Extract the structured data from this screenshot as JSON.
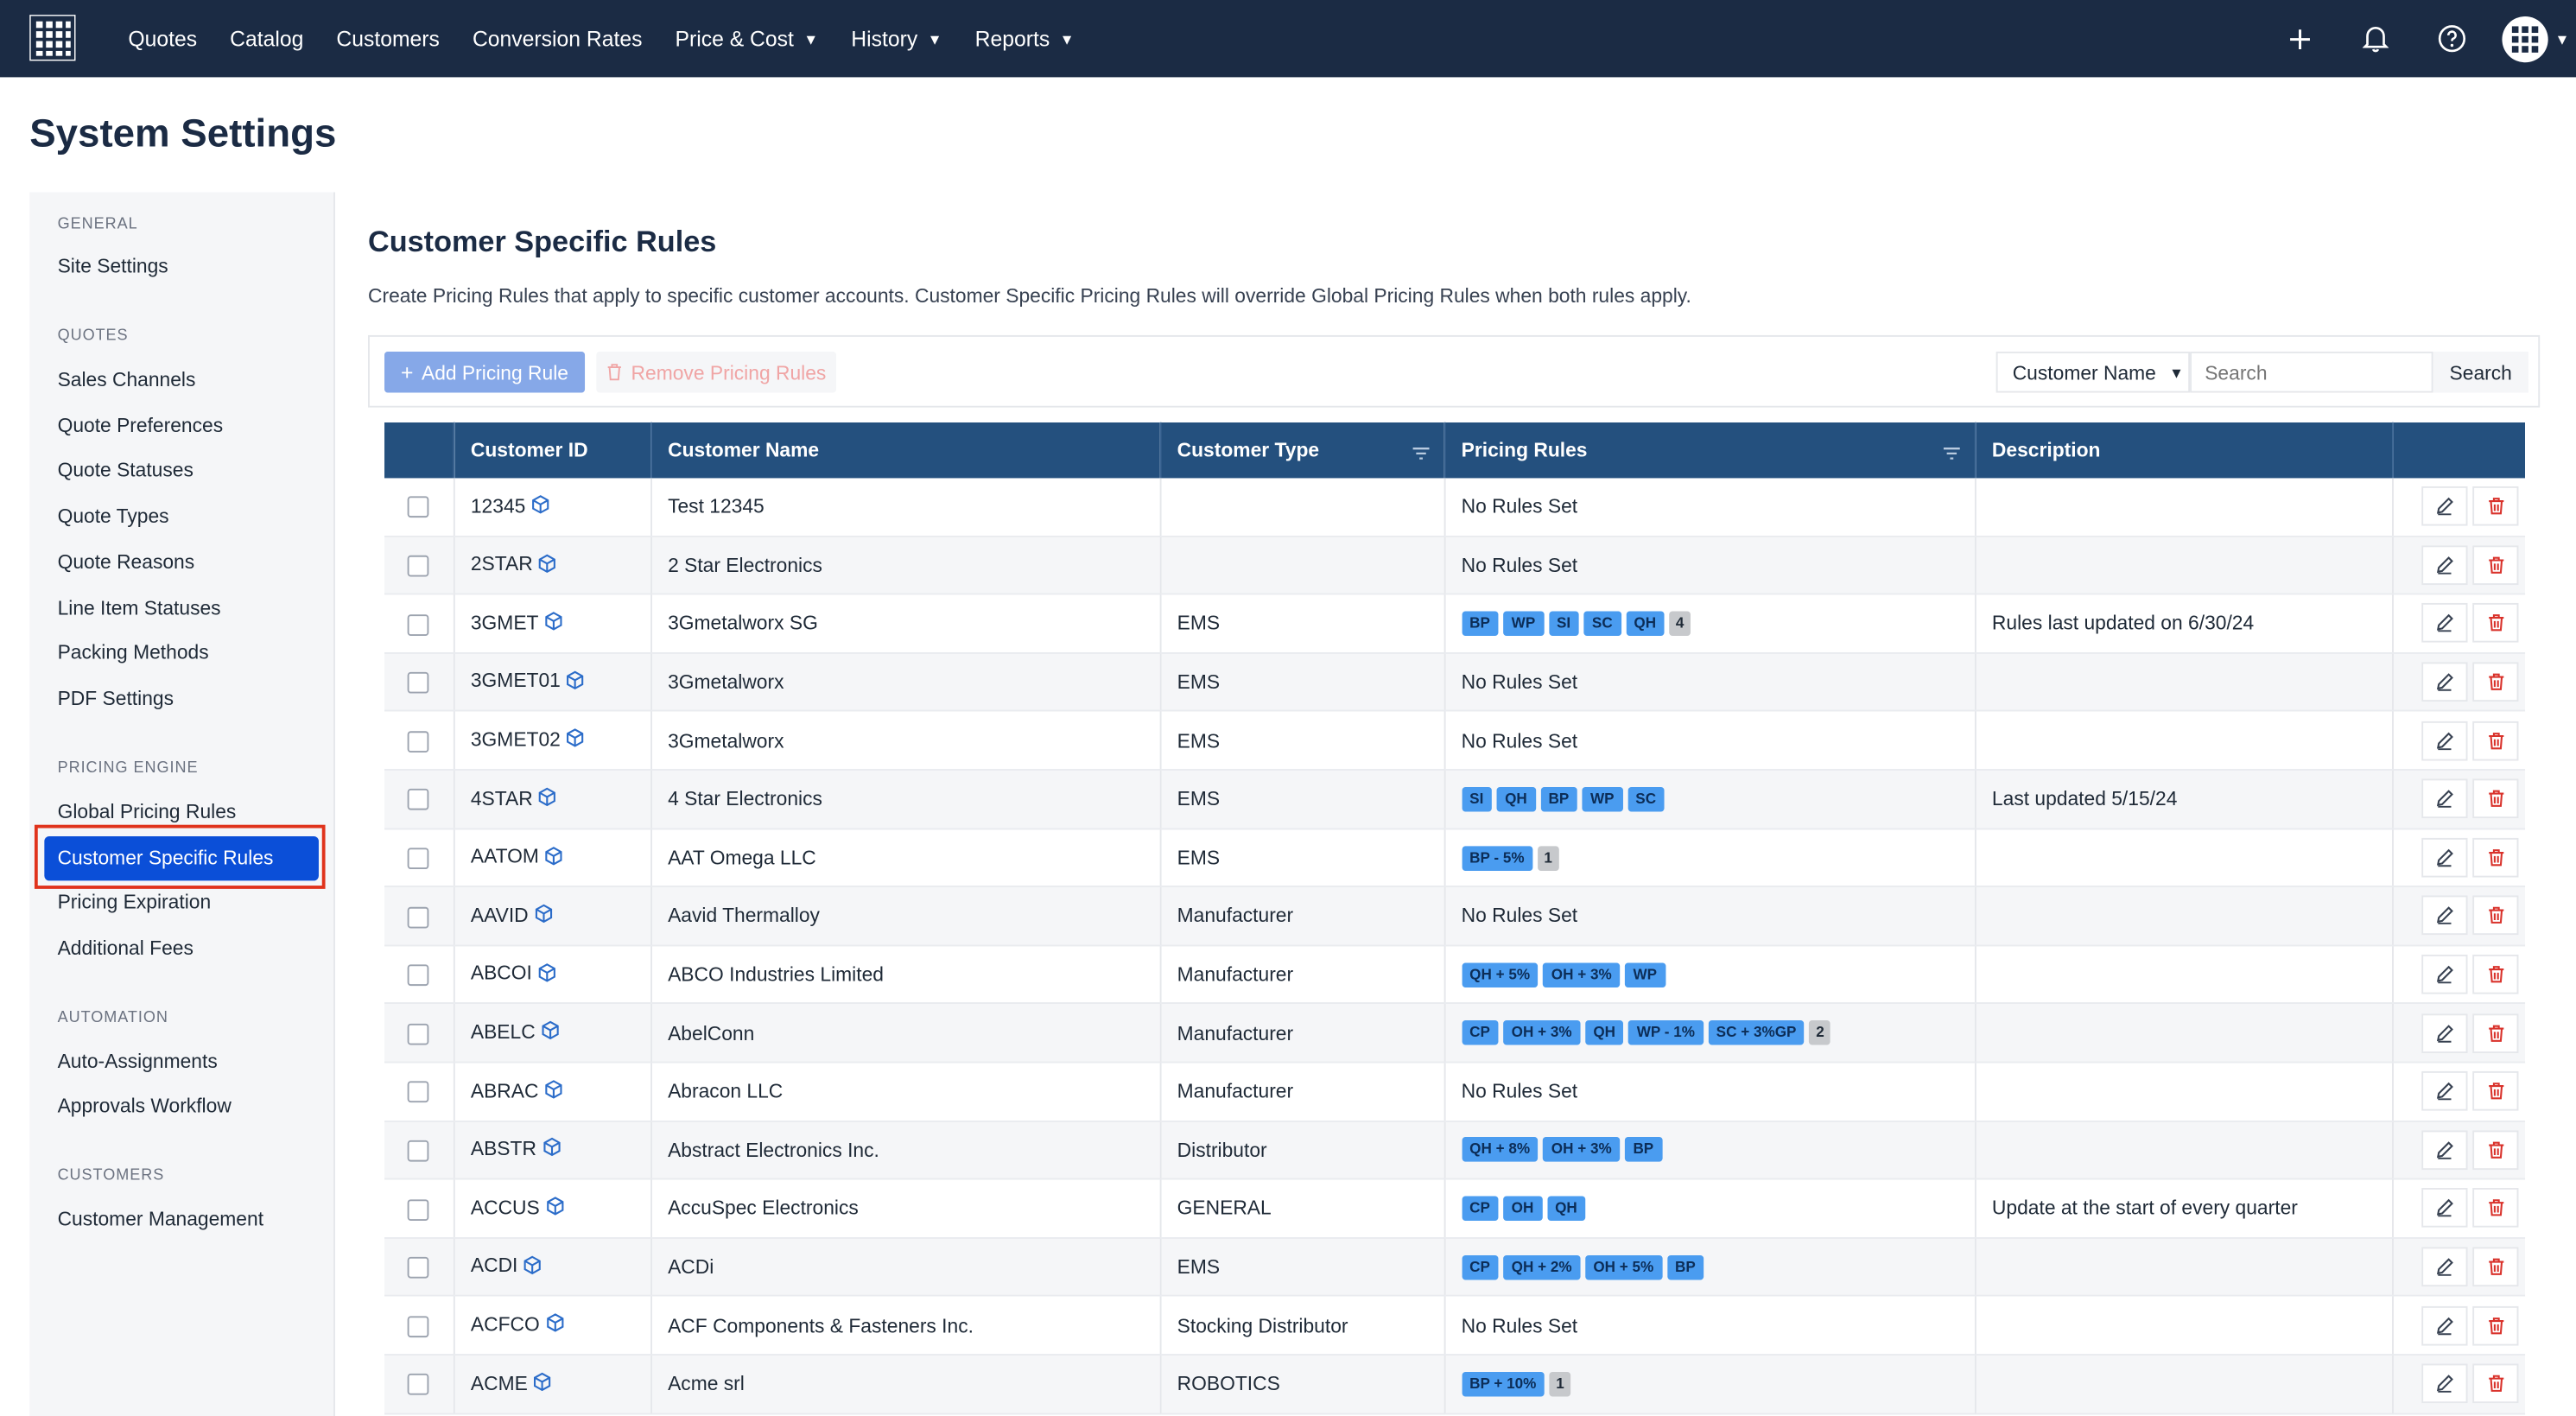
{
  "nav": {
    "items": [
      {
        "label": "Quotes",
        "dropdown": false
      },
      {
        "label": "Catalog",
        "dropdown": false
      },
      {
        "label": "Customers",
        "dropdown": false
      },
      {
        "label": "Conversion Rates",
        "dropdown": false
      },
      {
        "label": "Price & Cost",
        "dropdown": true
      },
      {
        "label": "History",
        "dropdown": true
      },
      {
        "label": "Reports",
        "dropdown": true
      }
    ],
    "icons": [
      "plus-icon",
      "bell-icon",
      "help-icon",
      "avatar"
    ]
  },
  "page": {
    "title": "System Settings"
  },
  "sidebar": {
    "sections": [
      {
        "heading": "GENERAL",
        "items": [
          "Site Settings"
        ]
      },
      {
        "heading": "QUOTES",
        "items": [
          "Sales Channels",
          "Quote Preferences",
          "Quote Statuses",
          "Quote Types",
          "Quote Reasons",
          "Line Item Statuses",
          "Packing Methods",
          "PDF Settings"
        ]
      },
      {
        "heading": "PRICING ENGINE",
        "items": [
          "Global Pricing Rules",
          "Customer Specific Rules",
          "Pricing Expiration",
          "Additional Fees"
        ]
      },
      {
        "heading": "AUTOMATION",
        "items": [
          "Auto-Assignments",
          "Approvals Workflow"
        ]
      },
      {
        "heading": "CUSTOMERS",
        "items": [
          "Customer Management"
        ]
      }
    ],
    "active": "Customer Specific Rules"
  },
  "main": {
    "title": "Customer Specific Rules",
    "description": "Create Pricing Rules that apply to specific customer accounts. Customer Specific Pricing Rules will override Global Pricing Rules when both rules apply.",
    "add_label": "Add Pricing Rule",
    "remove_label": "Remove Pricing Rules",
    "search_field": "Customer Name",
    "search_placeholder": "Search",
    "search_button": "Search"
  },
  "colors": {
    "accent": "#0b4fd8",
    "header": "#1b2b44",
    "table_header": "#24507e",
    "tag": "#4a9cf0",
    "delete": "#d9322b",
    "highlight": "#e0331c"
  },
  "table": {
    "columns": [
      "Customer ID",
      "Customer Name",
      "Customer Type",
      "Pricing Rules",
      "Description"
    ],
    "rows": [
      {
        "id": "12345",
        "name": "Test 12345",
        "type": "",
        "rules_text": "No Rules Set",
        "tags": [],
        "more": "",
        "desc": ""
      },
      {
        "id": "2STAR",
        "name": "2 Star Electronics",
        "type": "",
        "rules_text": "No Rules Set",
        "tags": [],
        "more": "",
        "desc": ""
      },
      {
        "id": "3GMET",
        "name": "3Gmetalworx SG",
        "type": "EMS",
        "rules_text": "",
        "tags": [
          "BP",
          "WP",
          "SI",
          "SC",
          "QH"
        ],
        "more": "4",
        "desc": "Rules last updated on 6/30/24"
      },
      {
        "id": "3GMET01",
        "name": "3Gmetalworx",
        "type": "EMS",
        "rules_text": "No Rules Set",
        "tags": [],
        "more": "",
        "desc": ""
      },
      {
        "id": "3GMET02",
        "name": "3Gmetalworx",
        "type": "EMS",
        "rules_text": "No Rules Set",
        "tags": [],
        "more": "",
        "desc": ""
      },
      {
        "id": "4STAR",
        "name": "4 Star Electronics",
        "type": "EMS",
        "rules_text": "",
        "tags": [
          "SI",
          "QH",
          "BP",
          "WP",
          "SC"
        ],
        "more": "",
        "desc": "Last updated 5/15/24"
      },
      {
        "id": "AATOM",
        "name": "AAT Omega LLC",
        "type": "EMS",
        "rules_text": "",
        "tags": [
          "BP - 5%"
        ],
        "more": "1",
        "desc": ""
      },
      {
        "id": "AAVID",
        "name": "Aavid Thermalloy",
        "type": "Manufacturer",
        "rules_text": "No Rules Set",
        "tags": [],
        "more": "",
        "desc": ""
      },
      {
        "id": "ABCOI",
        "name": "ABCO Industries Limited",
        "type": "Manufacturer",
        "rules_text": "",
        "tags": [
          "QH + 5%",
          "OH + 3%",
          "WP"
        ],
        "more": "",
        "desc": ""
      },
      {
        "id": "ABELC",
        "name": "AbelConn",
        "type": "Manufacturer",
        "rules_text": "",
        "tags": [
          "CP",
          "OH + 3%",
          "QH",
          "WP - 1%",
          "SC + 3%GP"
        ],
        "more": "2",
        "desc": ""
      },
      {
        "id": "ABRAC",
        "name": "Abracon LLC",
        "type": "Manufacturer",
        "rules_text": "No Rules Set",
        "tags": [],
        "more": "",
        "desc": ""
      },
      {
        "id": "ABSTR",
        "name": "Abstract Electronics Inc.",
        "type": "Distributor",
        "rules_text": "",
        "tags": [
          "QH + 8%",
          "OH + 3%",
          "BP"
        ],
        "more": "",
        "desc": ""
      },
      {
        "id": "ACCUS",
        "name": "AccuSpec Electronics",
        "type": "GENERAL",
        "rules_text": "",
        "tags": [
          "CP",
          "OH",
          "QH"
        ],
        "more": "",
        "desc": "Update at the start of every quarter"
      },
      {
        "id": "ACDI",
        "name": "ACDi",
        "type": "EMS",
        "rules_text": "",
        "tags": [
          "CP",
          "QH + 2%",
          "OH + 5%",
          "BP"
        ],
        "more": "",
        "desc": ""
      },
      {
        "id": "ACFCO",
        "name": "ACF Components & Fasteners Inc.",
        "type": "Stocking Distributor",
        "rules_text": "No Rules Set",
        "tags": [],
        "more": "",
        "desc": ""
      },
      {
        "id": "ACME",
        "name": "Acme srl",
        "type": "ROBOTICS",
        "rules_text": "",
        "tags": [
          "BP + 10%"
        ],
        "more": "1",
        "desc": ""
      }
    ]
  }
}
